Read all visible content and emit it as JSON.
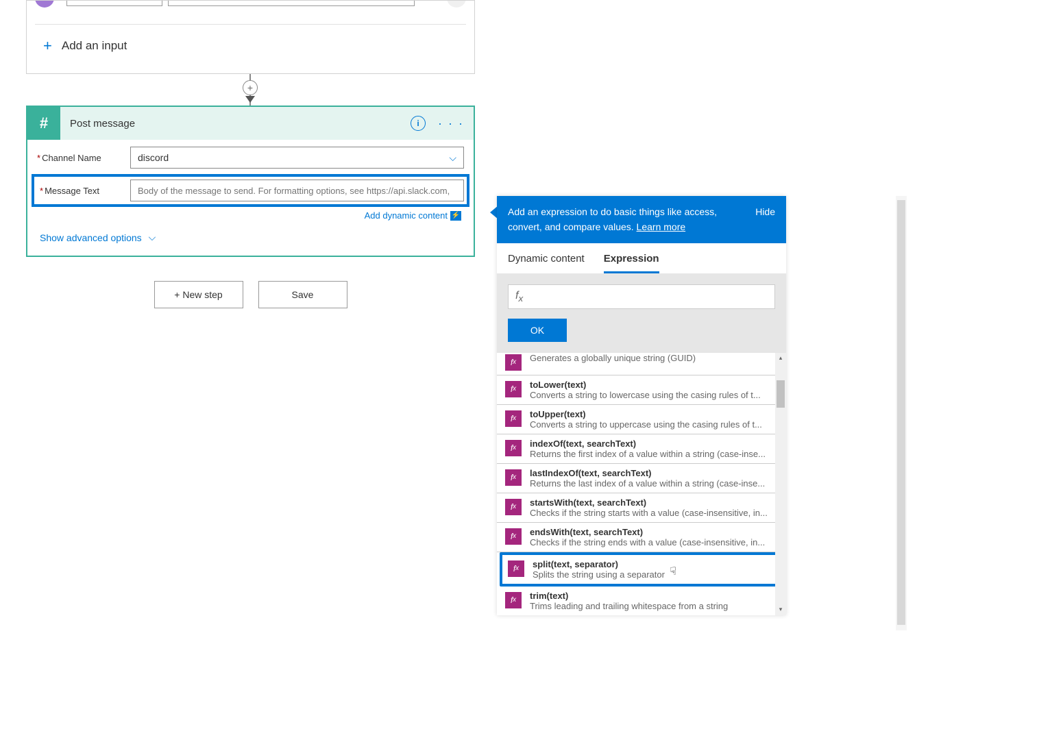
{
  "triggerCard": {
    "addInputLabel": "Add an input"
  },
  "postMessage": {
    "title": "Post message",
    "channelNameLabel": "Channel Name",
    "channelNameValue": "discord",
    "messageTextLabel": "Message Text",
    "messageTextPlaceholder": "Body of the message to send. For formatting options, see https://api.slack.com,",
    "addDynamicContent": "Add dynamic content",
    "showAdvanced": "Show advanced options"
  },
  "buttons": {
    "newStep": "+ New step",
    "save": "Save"
  },
  "expressionPanel": {
    "headerText": "Add an expression to do basic things like access, convert, and compare values. ",
    "learnMore": "Learn more",
    "hide": "Hide",
    "tabDynamic": "Dynamic content",
    "tabExpression": "Expression",
    "okButton": "OK",
    "functions": [
      {
        "name": "",
        "desc": "Generates a globally unique string (GUID)"
      },
      {
        "name": "toLower(text)",
        "desc": "Converts a string to lowercase using the casing rules of t..."
      },
      {
        "name": "toUpper(text)",
        "desc": "Converts a string to uppercase using the casing rules of t..."
      },
      {
        "name": "indexOf(text, searchText)",
        "desc": "Returns the first index of a value within a string (case-inse..."
      },
      {
        "name": "lastIndexOf(text, searchText)",
        "desc": "Returns the last index of a value within a string (case-inse..."
      },
      {
        "name": "startsWith(text, searchText)",
        "desc": "Checks if the string starts with a value (case-insensitive, in..."
      },
      {
        "name": "endsWith(text, searchText)",
        "desc": "Checks if the string ends with a value (case-insensitive, in..."
      },
      {
        "name": "split(text, separator)",
        "desc": "Splits the string using a separator"
      },
      {
        "name": "trim(text)",
        "desc": "Trims leading and trailing whitespace from a string"
      }
    ]
  }
}
